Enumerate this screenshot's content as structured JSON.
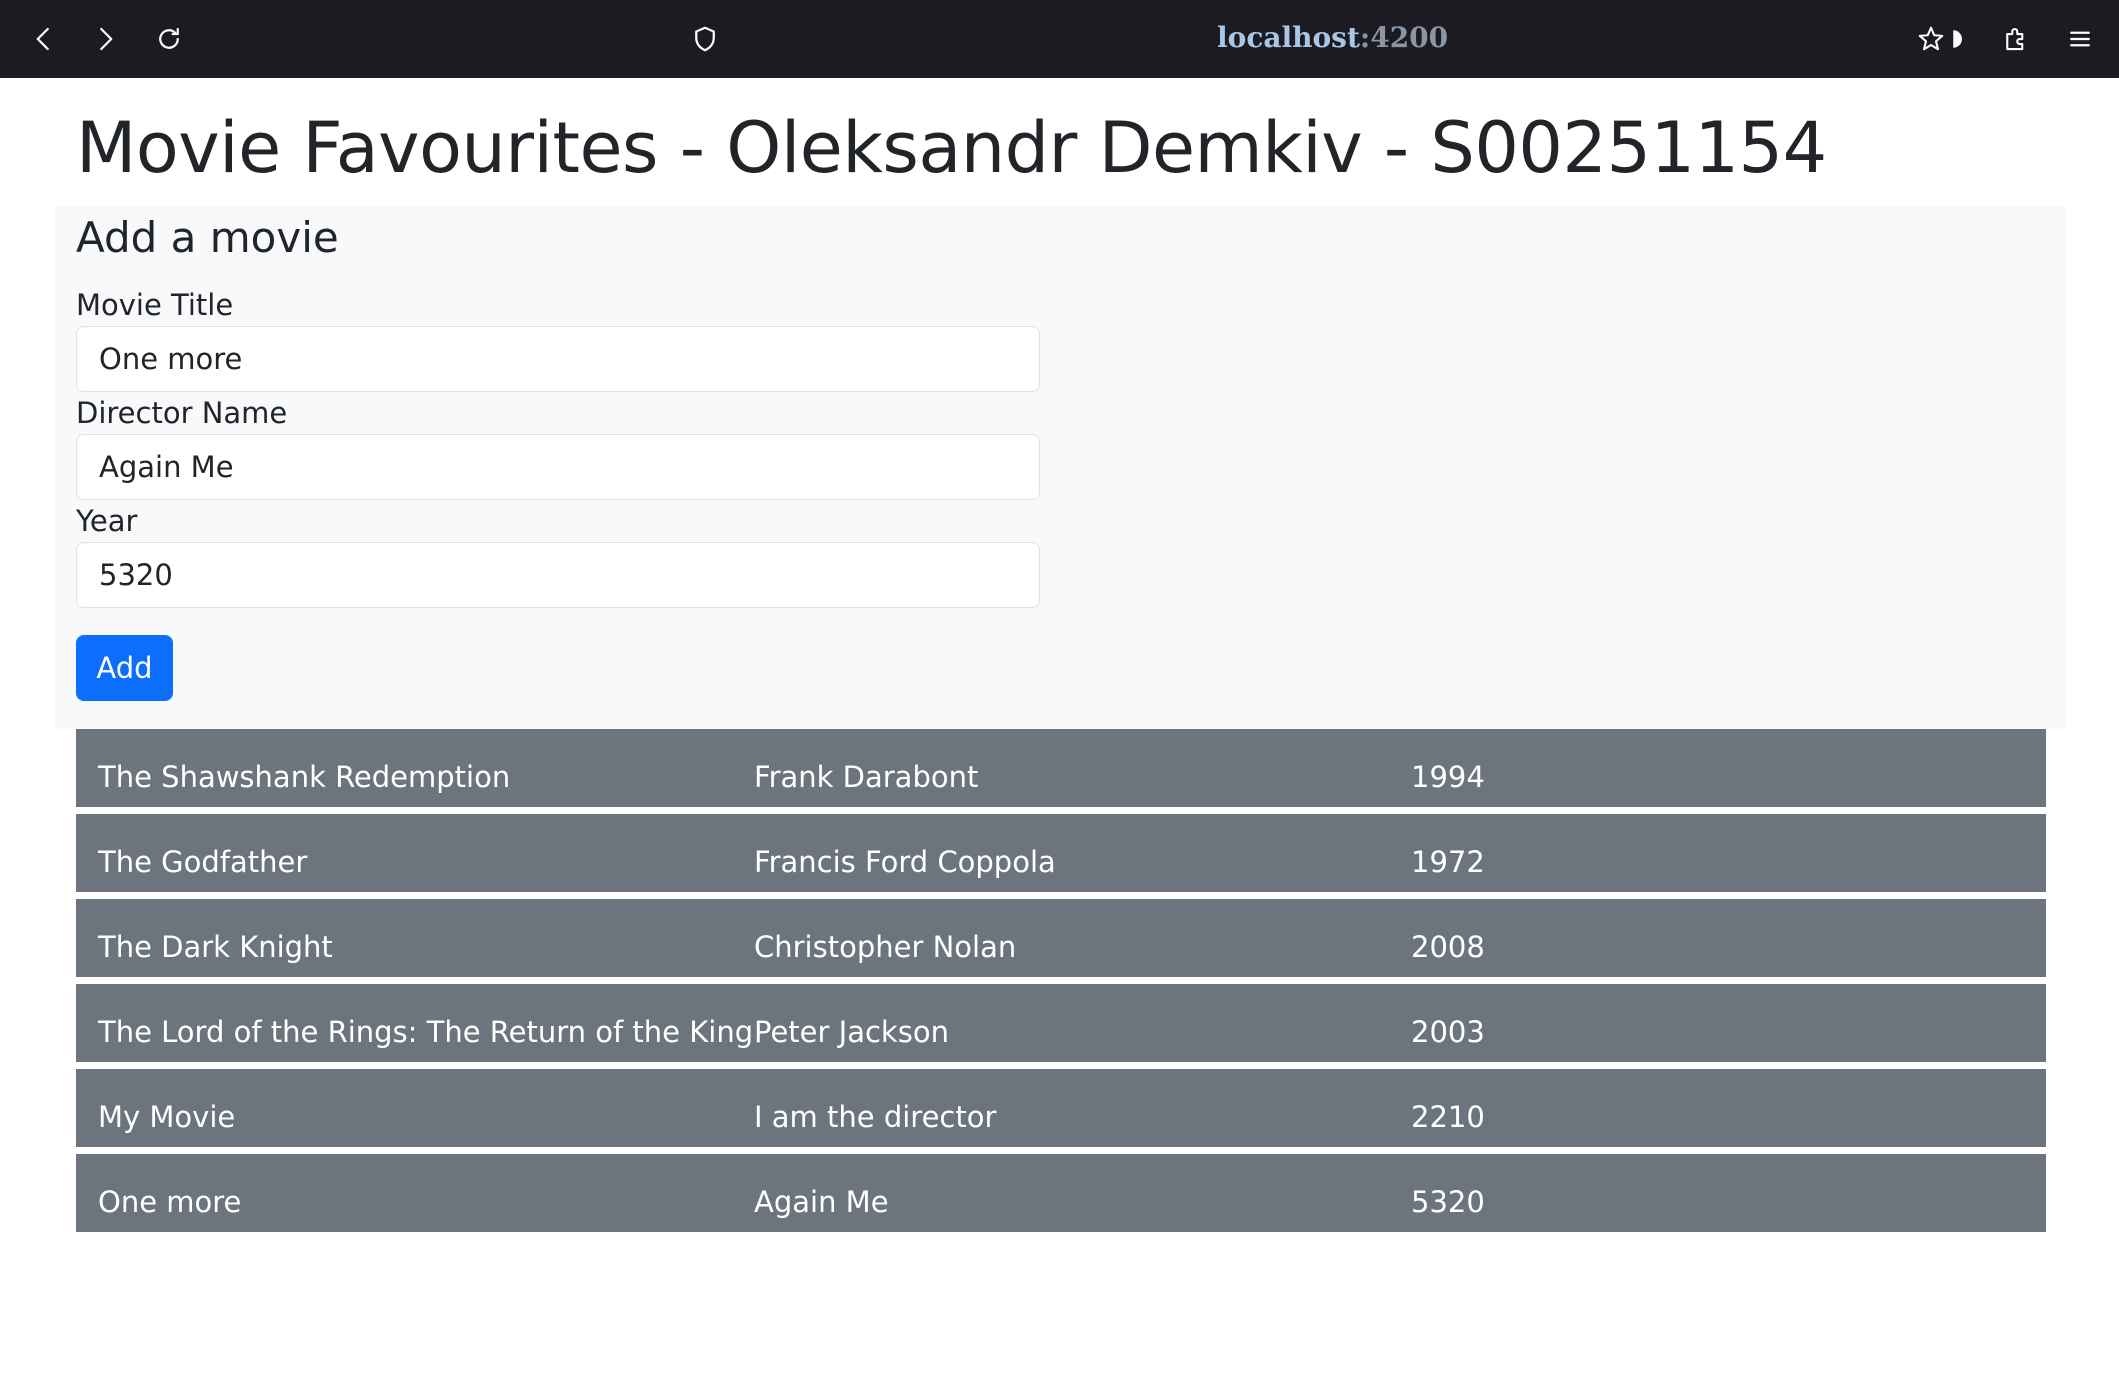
{
  "browser": {
    "url_host": "localhost",
    "url_port": ":4200"
  },
  "page": {
    "title": "Movie Favourites - Oleksandr Demkiv - S00251154"
  },
  "form": {
    "heading": "Add a movie",
    "title_label": "Movie Title",
    "title_value": "One more",
    "director_label": "Director Name",
    "director_value": "Again Me",
    "year_label": "Year",
    "year_value": "5320",
    "add_label": "Add"
  },
  "movies": [
    {
      "title": "The Shawshank Redemption",
      "director": "Frank Darabont",
      "year": "1994"
    },
    {
      "title": "The Godfather",
      "director": "Francis Ford Coppola",
      "year": "1972"
    },
    {
      "title": "The Dark Knight",
      "director": "Christopher Nolan",
      "year": "2008"
    },
    {
      "title": "The Lord of the Rings: The Return of the King",
      "director": "Peter Jackson",
      "year": "2003"
    },
    {
      "title": "My Movie",
      "director": "I am the director",
      "year": "2210"
    },
    {
      "title": "One more",
      "director": "Again Me",
      "year": "5320"
    }
  ],
  "colors": {
    "toolbar_bg": "#1c1b22",
    "panel_bg": "#f8f9fa",
    "primary_button": "#0d6efd",
    "row_bg": "#6c757d"
  },
  "icons": [
    "back-icon",
    "forward-icon",
    "reload-icon",
    "shield-icon",
    "bookmark-star-icon",
    "extensions-icon",
    "menu-icon"
  ]
}
